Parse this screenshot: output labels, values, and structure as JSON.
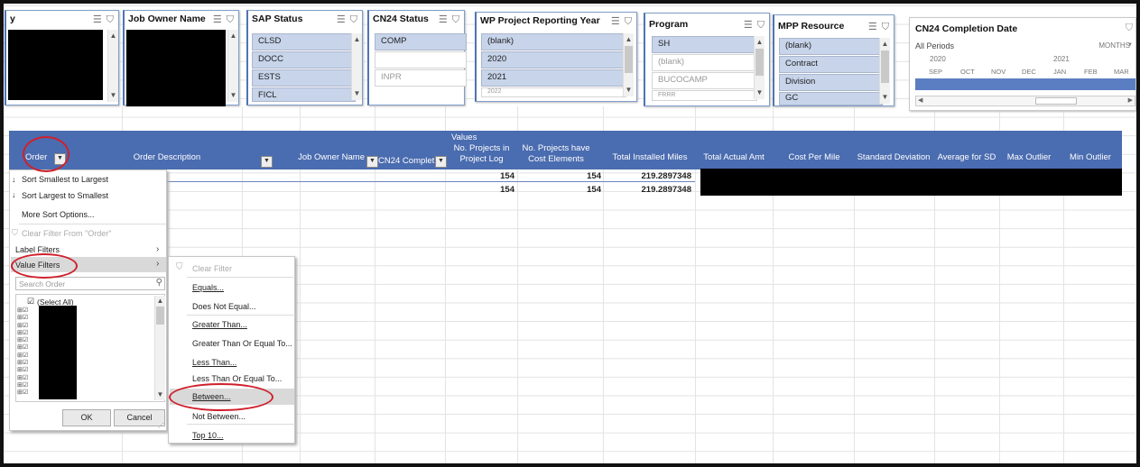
{
  "slicers": {
    "first": {
      "title": "y"
    },
    "job_owner": {
      "title": "Job Owner Name"
    },
    "sap_status": {
      "title": "SAP Status",
      "items": [
        "CLSD",
        "DOCC",
        "ESTS",
        "FICL"
      ]
    },
    "cn24_status": {
      "title": "CN24 Status",
      "items": [
        "COMP",
        "",
        "INPR"
      ]
    },
    "wp_year": {
      "title": "WP Project Reporting Year",
      "items": [
        "(blank)",
        "2020",
        "2021",
        "2022"
      ]
    },
    "program": {
      "title": "Program",
      "items": [
        "SH",
        "(blank)",
        "BUCOCAMP",
        "FRRR"
      ]
    },
    "mpp_resource": {
      "title": "MPP Resource",
      "items": [
        "(blank)",
        "Contract",
        "Division",
        "GC"
      ]
    },
    "cn24_completion": {
      "title": "CN24 Completion Date",
      "period_label": "All Periods",
      "unit_label": "MONTHS",
      "years": [
        "2020",
        "2021"
      ],
      "months": [
        "SEP",
        "OCT",
        "NOV",
        "DEC",
        "JAN",
        "FEB",
        "MAR"
      ]
    }
  },
  "pivot": {
    "values_label": "Values",
    "columns": {
      "order": "Order",
      "order_description": "Order Description",
      "job_owner_name": "Job Owner Name",
      "cn24_complete": "CN24 Complet",
      "projects_in_log": "No. Projects in Project Log",
      "projects_have_cost": "No. Projects have Cost Elements",
      "total_installed_miles": "Total Installed Miles",
      "total_actual_amt": "Total Actual Amt",
      "cost_per_mile": "Cost Per Mile",
      "standard_deviation": "Standard Deviation",
      "average_for_sd": "Average for SD",
      "max_outlier": "Max Outlier",
      "min_outlier": "Min Outlier"
    },
    "rows": [
      {
        "projects_in_log": "154",
        "projects_have_cost": "154",
        "total_installed_miles": "219.2897348"
      },
      {
        "projects_in_log": "154",
        "projects_have_cost": "154",
        "total_installed_miles": "219.2897348"
      }
    ]
  },
  "filter_menu": {
    "sort_asc": "Sort Smallest to Largest",
    "sort_desc": "Sort Largest to Smallest",
    "more_sort": "More Sort Options...",
    "clear_filter": "Clear Filter From \"Order\"",
    "label_filters": "Label Filters",
    "value_filters": "Value Filters",
    "search_placeholder": "Search Order",
    "select_all": "(Select All)",
    "ok": "OK",
    "cancel": "Cancel"
  },
  "value_filters_menu": {
    "clear_filter": "Clear Filter",
    "items": [
      "Equals...",
      "Does Not Equal...",
      "Greater Than...",
      "Greater Than Or Equal To...",
      "Less Than...",
      "Less Than Or Equal To...",
      "Between...",
      "Not Between...",
      "Top 10..."
    ]
  },
  "colors": {
    "header_blue": "#4a6cb0",
    "slicer_item": "#c7d4ea",
    "highlight_red": "#d0202c"
  }
}
